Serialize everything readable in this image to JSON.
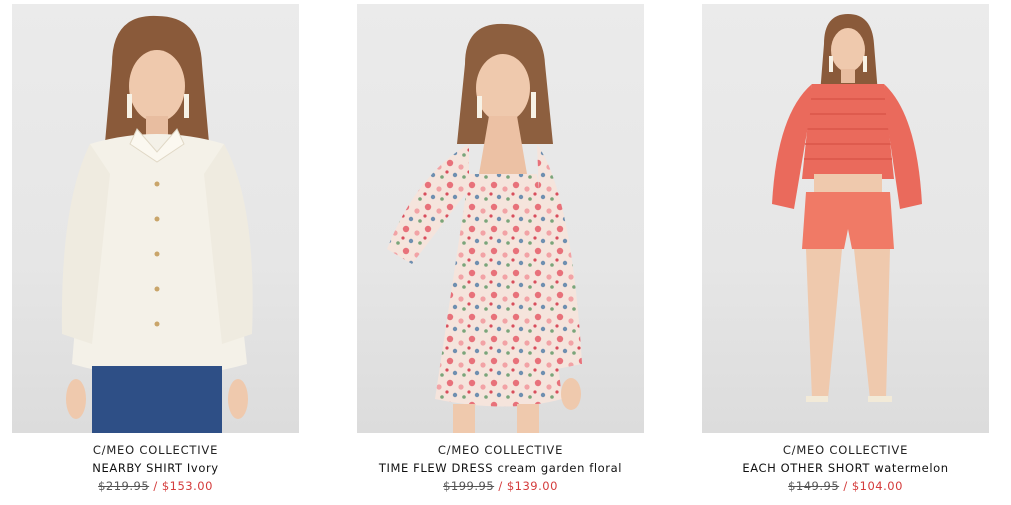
{
  "products": [
    {
      "brand": "C/MEO COLLECTIVE",
      "name": "NEARBY SHIRT Ivory",
      "original_price": "$219.95",
      "separator": "/",
      "sale_price": "$153.00",
      "image_alt": "model wearing ivory shirt with blue jeans"
    },
    {
      "brand": "C/MEO COLLECTIVE",
      "name": "TIME FLEW DRESS cream garden floral",
      "original_price": "$199.95",
      "separator": "/",
      "sale_price": "$139.00",
      "image_alt": "model wearing cream floral mini dress"
    },
    {
      "brand": "C/MEO COLLECTIVE",
      "name": "EACH OTHER SHORT watermelon",
      "original_price": "$149.95",
      "separator": "/",
      "sale_price": "$104.00",
      "image_alt": "model wearing watermelon ruffle top and shorts"
    }
  ],
  "colors": {
    "sale_price": "#d43b3b",
    "background": "#ffffff",
    "ivory": "#f4f1e8",
    "denim": "#2e4f86",
    "floral_base": "#f5e4dc",
    "watermelon": "#ea6a5c"
  }
}
